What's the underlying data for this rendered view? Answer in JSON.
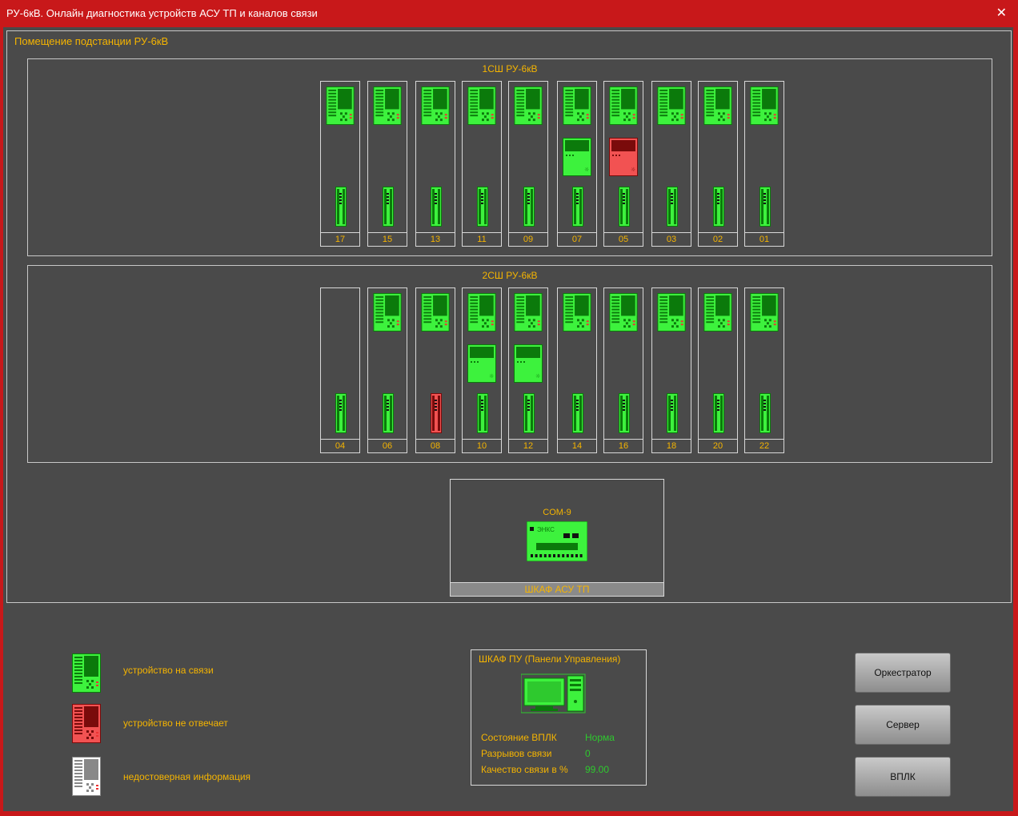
{
  "window": {
    "title": "РУ-6кВ. Онлайн диагностика устройств АСУ ТП и каналов связи"
  },
  "room": {
    "title": "Помещение подстанции РУ-6кВ"
  },
  "sections": [
    {
      "title": "1СШ РУ-6кВ",
      "bays": [
        {
          "label": "17",
          "relay": "ok",
          "meter": null,
          "term": "ok"
        },
        {
          "label": "15",
          "relay": "ok",
          "meter": null,
          "term": "ok"
        },
        {
          "label": "13",
          "relay": "ok",
          "meter": null,
          "term": "ok"
        },
        {
          "label": "11",
          "relay": "ok",
          "meter": null,
          "term": "ok"
        },
        {
          "label": "09",
          "relay": "ok",
          "meter": null,
          "term": "ok"
        },
        {
          "label": "07",
          "relay": "ok",
          "meter": "ok",
          "term": "ok"
        },
        {
          "label": "05",
          "relay": "ok",
          "meter": "fail",
          "term": "ok"
        },
        {
          "label": "03",
          "relay": "ok",
          "meter": null,
          "term": "ok"
        },
        {
          "label": "02",
          "relay": "ok",
          "meter": null,
          "term": "ok"
        },
        {
          "label": "01",
          "relay": "ok",
          "meter": null,
          "term": "ok"
        }
      ]
    },
    {
      "title": "2СШ РУ-6кВ",
      "bays": [
        {
          "label": "04",
          "relay": null,
          "meter": null,
          "term": "ok"
        },
        {
          "label": "06",
          "relay": "ok",
          "meter": null,
          "term": "ok"
        },
        {
          "label": "08",
          "relay": "ok",
          "meter": null,
          "term": "fail"
        },
        {
          "label": "10",
          "relay": "ok",
          "meter": "ok",
          "term": "ok"
        },
        {
          "label": "12",
          "relay": "ok",
          "meter": "ok",
          "term": "ok"
        },
        {
          "label": "14",
          "relay": "ok",
          "meter": null,
          "term": "ok"
        },
        {
          "label": "16",
          "relay": "ok",
          "meter": null,
          "term": "ok"
        },
        {
          "label": "18",
          "relay": "ok",
          "meter": null,
          "term": "ok"
        },
        {
          "label": "20",
          "relay": "ok",
          "meter": null,
          "term": "ok"
        },
        {
          "label": "22",
          "relay": "ok",
          "meter": null,
          "term": "ok"
        }
      ]
    }
  ],
  "asu": {
    "label": "ШКАФ АСУ ТП",
    "com_label": "COM-9",
    "device_brand": "ЭНКС"
  },
  "legend": [
    {
      "state": "ok",
      "text": "устройство на связи"
    },
    {
      "state": "fail",
      "text": "устройство не отвечает"
    },
    {
      "state": "unknown",
      "text": "недостоверная информация"
    }
  ],
  "pu": {
    "title": "ШКАФ ПУ (Панели Управления)",
    "rows": [
      {
        "label": "Состояние ВПЛК",
        "value": "Норма"
      },
      {
        "label": "Разрывов связи",
        "value": "0"
      },
      {
        "label": "Качество связи в %",
        "value": "99.00"
      }
    ]
  },
  "buttons": {
    "orchestrator": "Оркестратор",
    "server": "Сервер",
    "vplk": "ВПЛК"
  },
  "colors": {
    "ok_bg": "#3df23d",
    "ok_dark": "#0b7a0b",
    "fail_bg": "#f25252",
    "fail_dark": "#7a0b0b",
    "unknown_bg": "#ffffff",
    "unknown_dark": "#888888",
    "accent_text": "#f5b400"
  }
}
